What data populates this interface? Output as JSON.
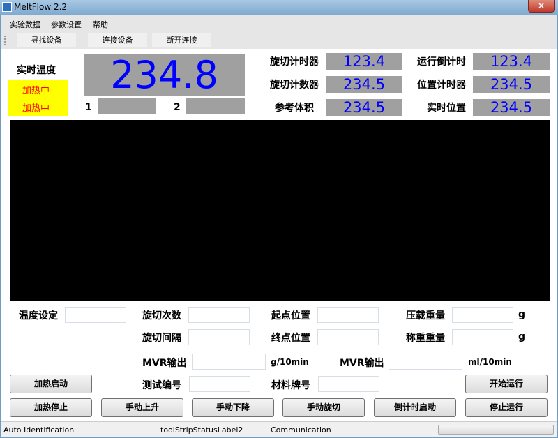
{
  "window": {
    "title": "MeltFlow 2.2",
    "close_icon": "×"
  },
  "menu": [
    "实验数据",
    "参数设置",
    "帮助"
  ],
  "toolbar": [
    "寻找设备",
    "连接设备",
    "断开连接"
  ],
  "temp": {
    "label": "实时温度",
    "value": "234.8",
    "status1": "加热中",
    "status2": "加热中",
    "ch1_label": "1",
    "ch2_label": "2",
    "status_bg": "#ffff00",
    "status_color": "#ff0000"
  },
  "readouts": [
    {
      "label": "旋切计时器",
      "value": "123.4"
    },
    {
      "label": "运行倒计时",
      "value": "123.4"
    },
    {
      "label": "旋切计数器",
      "value": "234.5"
    },
    {
      "label": "位置计时器",
      "value": "234.5"
    },
    {
      "label": "参考体积",
      "value": "234.5"
    },
    {
      "label": "实时位置",
      "value": "234.5"
    }
  ],
  "form": {
    "temp_set": "温度设定",
    "cut_count": "旋切次数",
    "start_pos": "起点位置",
    "load_weight": "压载重量",
    "cut_interval": "旋切间隔",
    "end_pos": "终点位置",
    "weigh_weight": "称重重量",
    "mvr1": "MVR输出",
    "mvr1_unit": "g/10min",
    "mvr2": "MVR输出",
    "mvr2_unit": "ml/10min",
    "test_no": "测试编号",
    "material": "材料牌号",
    "unit_g": "g"
  },
  "buttons": {
    "heat_start": "加热启动",
    "start_run": "开始运行",
    "heat_stop": "加热停止",
    "manual_up": "手动上升",
    "manual_down": "手动下降",
    "manual_cut": "手动旋切",
    "countdown_start": "倒计时启动",
    "stop_run": "停止运行"
  },
  "status": {
    "s1": "Auto Identification",
    "s2": "toolStripStatusLabel2",
    "s3": "Communication",
    "progress": 0
  }
}
